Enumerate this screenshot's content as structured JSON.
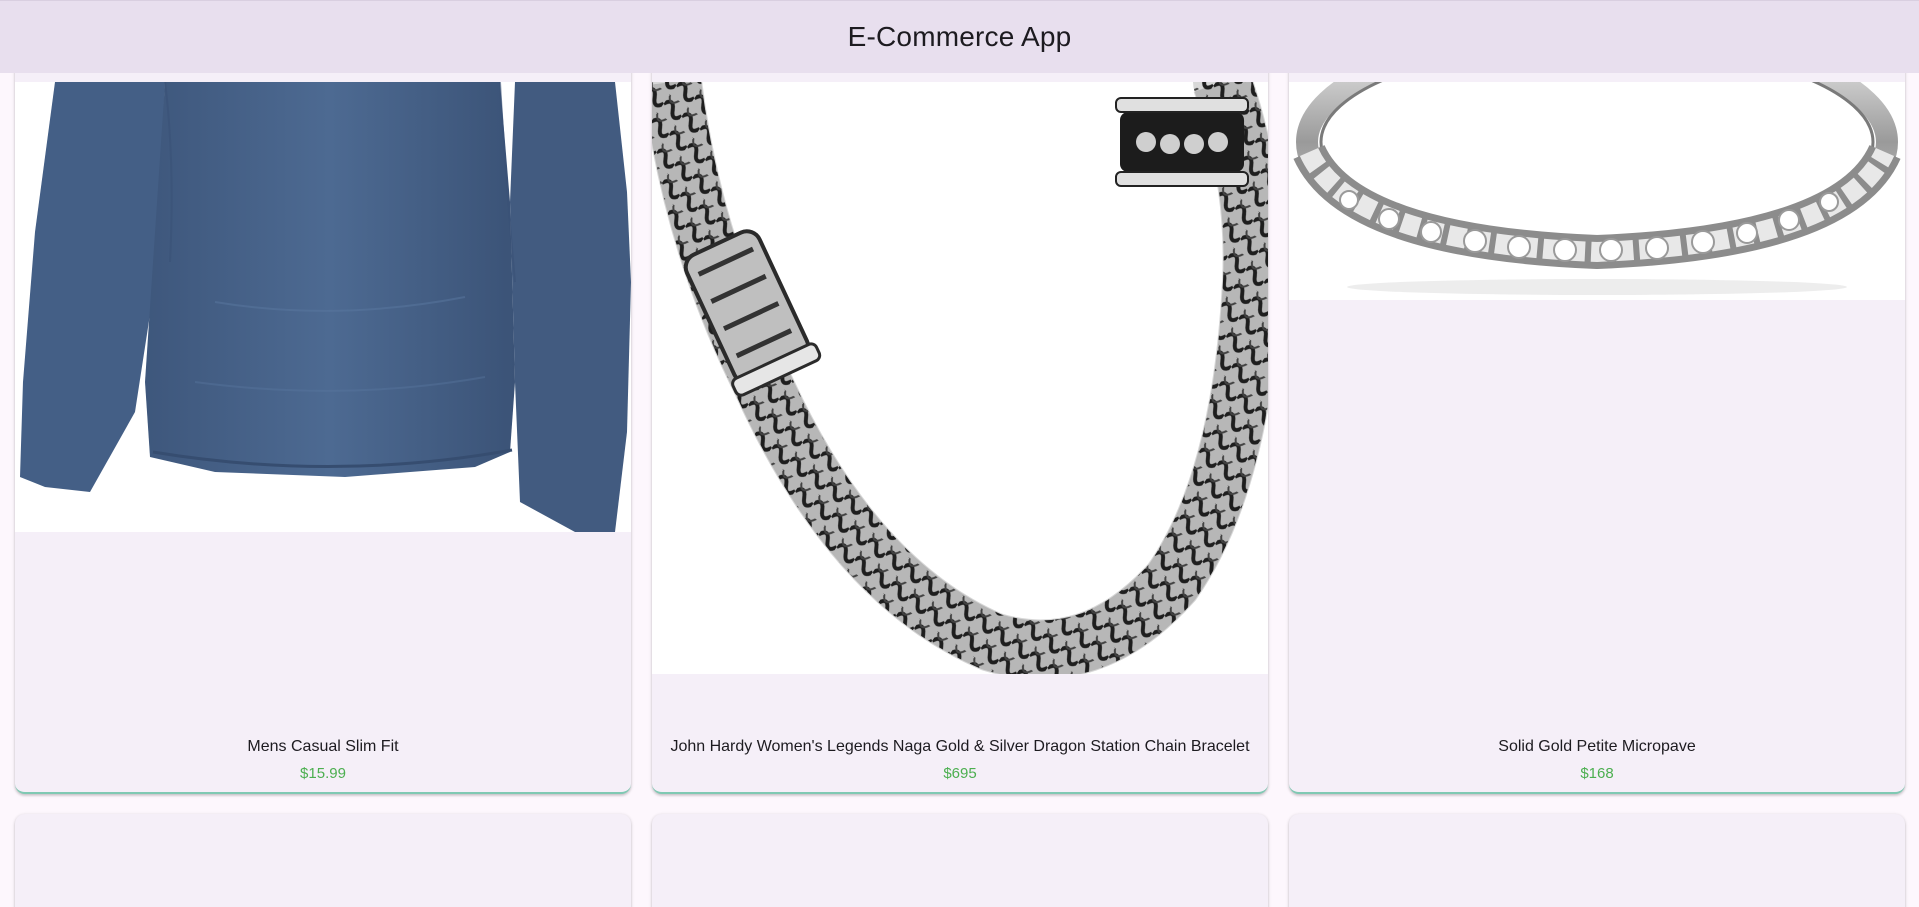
{
  "app_bar": {
    "title": "E-Commerce App"
  },
  "products": [
    {
      "title": "Mens Casual Slim Fit",
      "price": "$15.99",
      "image": "blue-long-sleeve-shirt"
    },
    {
      "title": "John Hardy Women's Legends Naga Gold & Silver Dragon Station Chain Bracelet",
      "price": "$695",
      "image": "silver-chain-bracelet"
    },
    {
      "title": "Solid Gold Petite Micropave",
      "price": "$168",
      "image": "diamond-band-ring"
    }
  ],
  "colors": {
    "app_bar_bg": "#e8dfee",
    "card_bg": "#f5eff8",
    "price": "#4caf50",
    "page_bg": "#fdf7fd"
  }
}
